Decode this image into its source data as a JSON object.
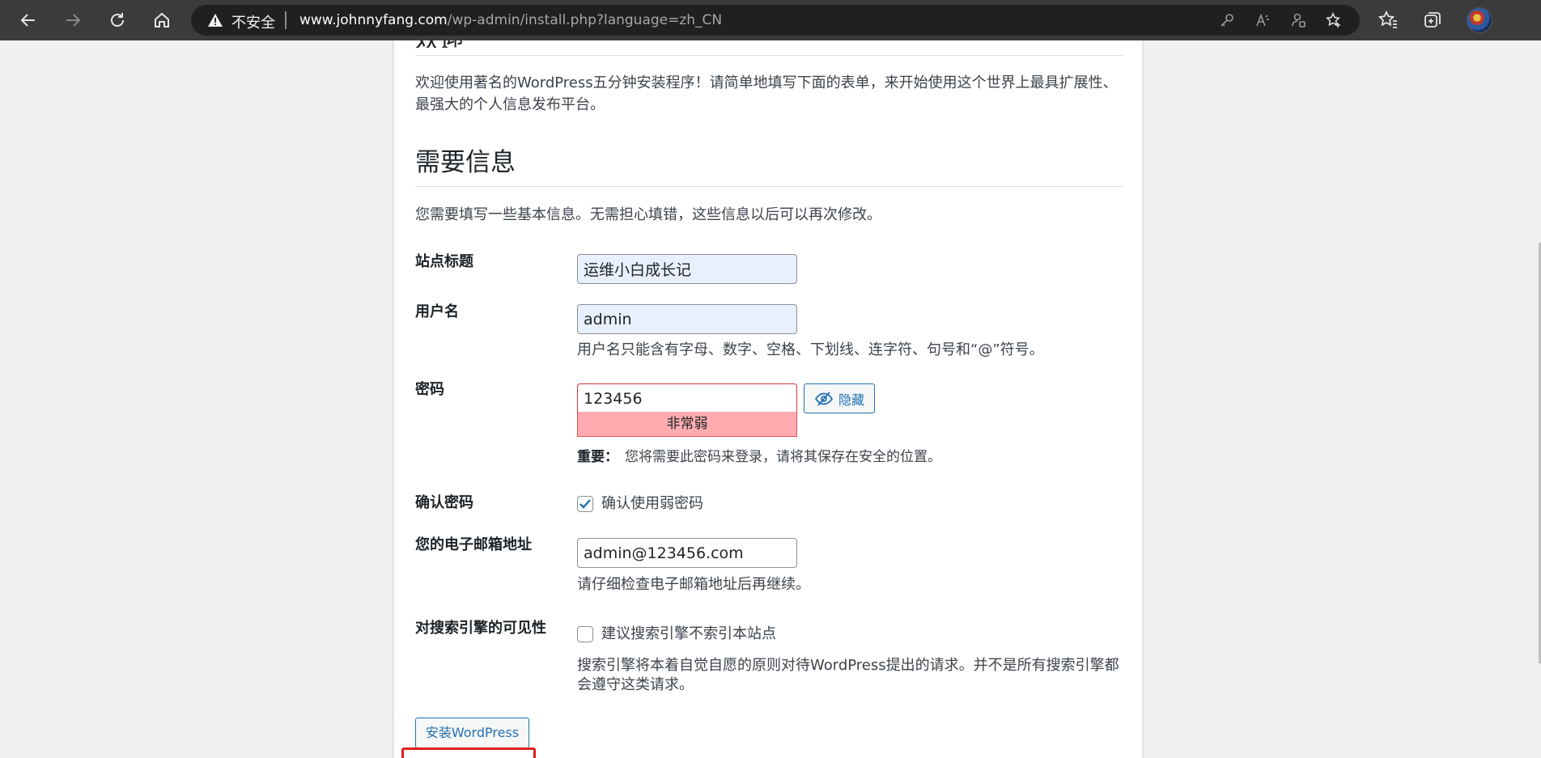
{
  "browser": {
    "security_label": "不安全",
    "url_host": "www.johnnyfang.com",
    "url_path": "/wp-admin/install.php?language=zh_CN",
    "icons": [
      "back-icon",
      "forward-icon",
      "refresh-icon",
      "home-icon",
      "warning-icon",
      "key-icon",
      "read-aloud-icon",
      "extension-icon",
      "favorite-add-icon",
      "favorites-icon",
      "collections-icon",
      "profile-avatar"
    ]
  },
  "page": {
    "partial_heading": "欢迎",
    "intro": "欢迎使用著名的WordPress五分钟安装程序！请简单地填写下面的表单，来开始使用这个世界上最具扩展性、最强大的个人信息发布平台。",
    "section_title": "需要信息",
    "section_desc": "您需要填写一些基本信息。无需担心填错，这些信息以后可以再次修改。",
    "fields": {
      "site_title": {
        "label": "站点标题",
        "value": "运维小白成长记"
      },
      "username": {
        "label": "用户名",
        "value": "admin",
        "hint": "用户名只能含有字母、数字、空格、下划线、连字符、句号和“@”符号。"
      },
      "password": {
        "label": "密码",
        "value": "123456",
        "strength": "非常弱",
        "hide_button": "隐藏",
        "important_label": "重要：",
        "important_text": "您将需要此密码来登录，请将其保存在安全的位置。"
      },
      "confirm_password": {
        "label": "确认密码",
        "checkbox_label": "确认使用弱密码",
        "checked": true
      },
      "email": {
        "label": "您的电子邮箱地址",
        "value": "admin@123456.com",
        "hint": "请仔细检查电子邮箱地址后再继续。"
      },
      "search_visibility": {
        "label": "对搜索引擎的可见性",
        "checkbox_label": "建议搜索引擎不索引本站点",
        "checked": false,
        "hint": "搜索引擎将本着自觉自愿的原则对待WordPress提出的请求。并不是所有搜索引擎都会遵守这类请求。"
      }
    },
    "submit_label": "安装WordPress"
  },
  "colors": {
    "toolbar_bg": "#3b3b3b",
    "address_bg": "#202020",
    "wp_blue": "#2271b1",
    "weak_bg": "#ffabaf",
    "weak_border": "#d63638",
    "highlight": "#e02020",
    "autofill_bg": "#e8f0fe"
  }
}
